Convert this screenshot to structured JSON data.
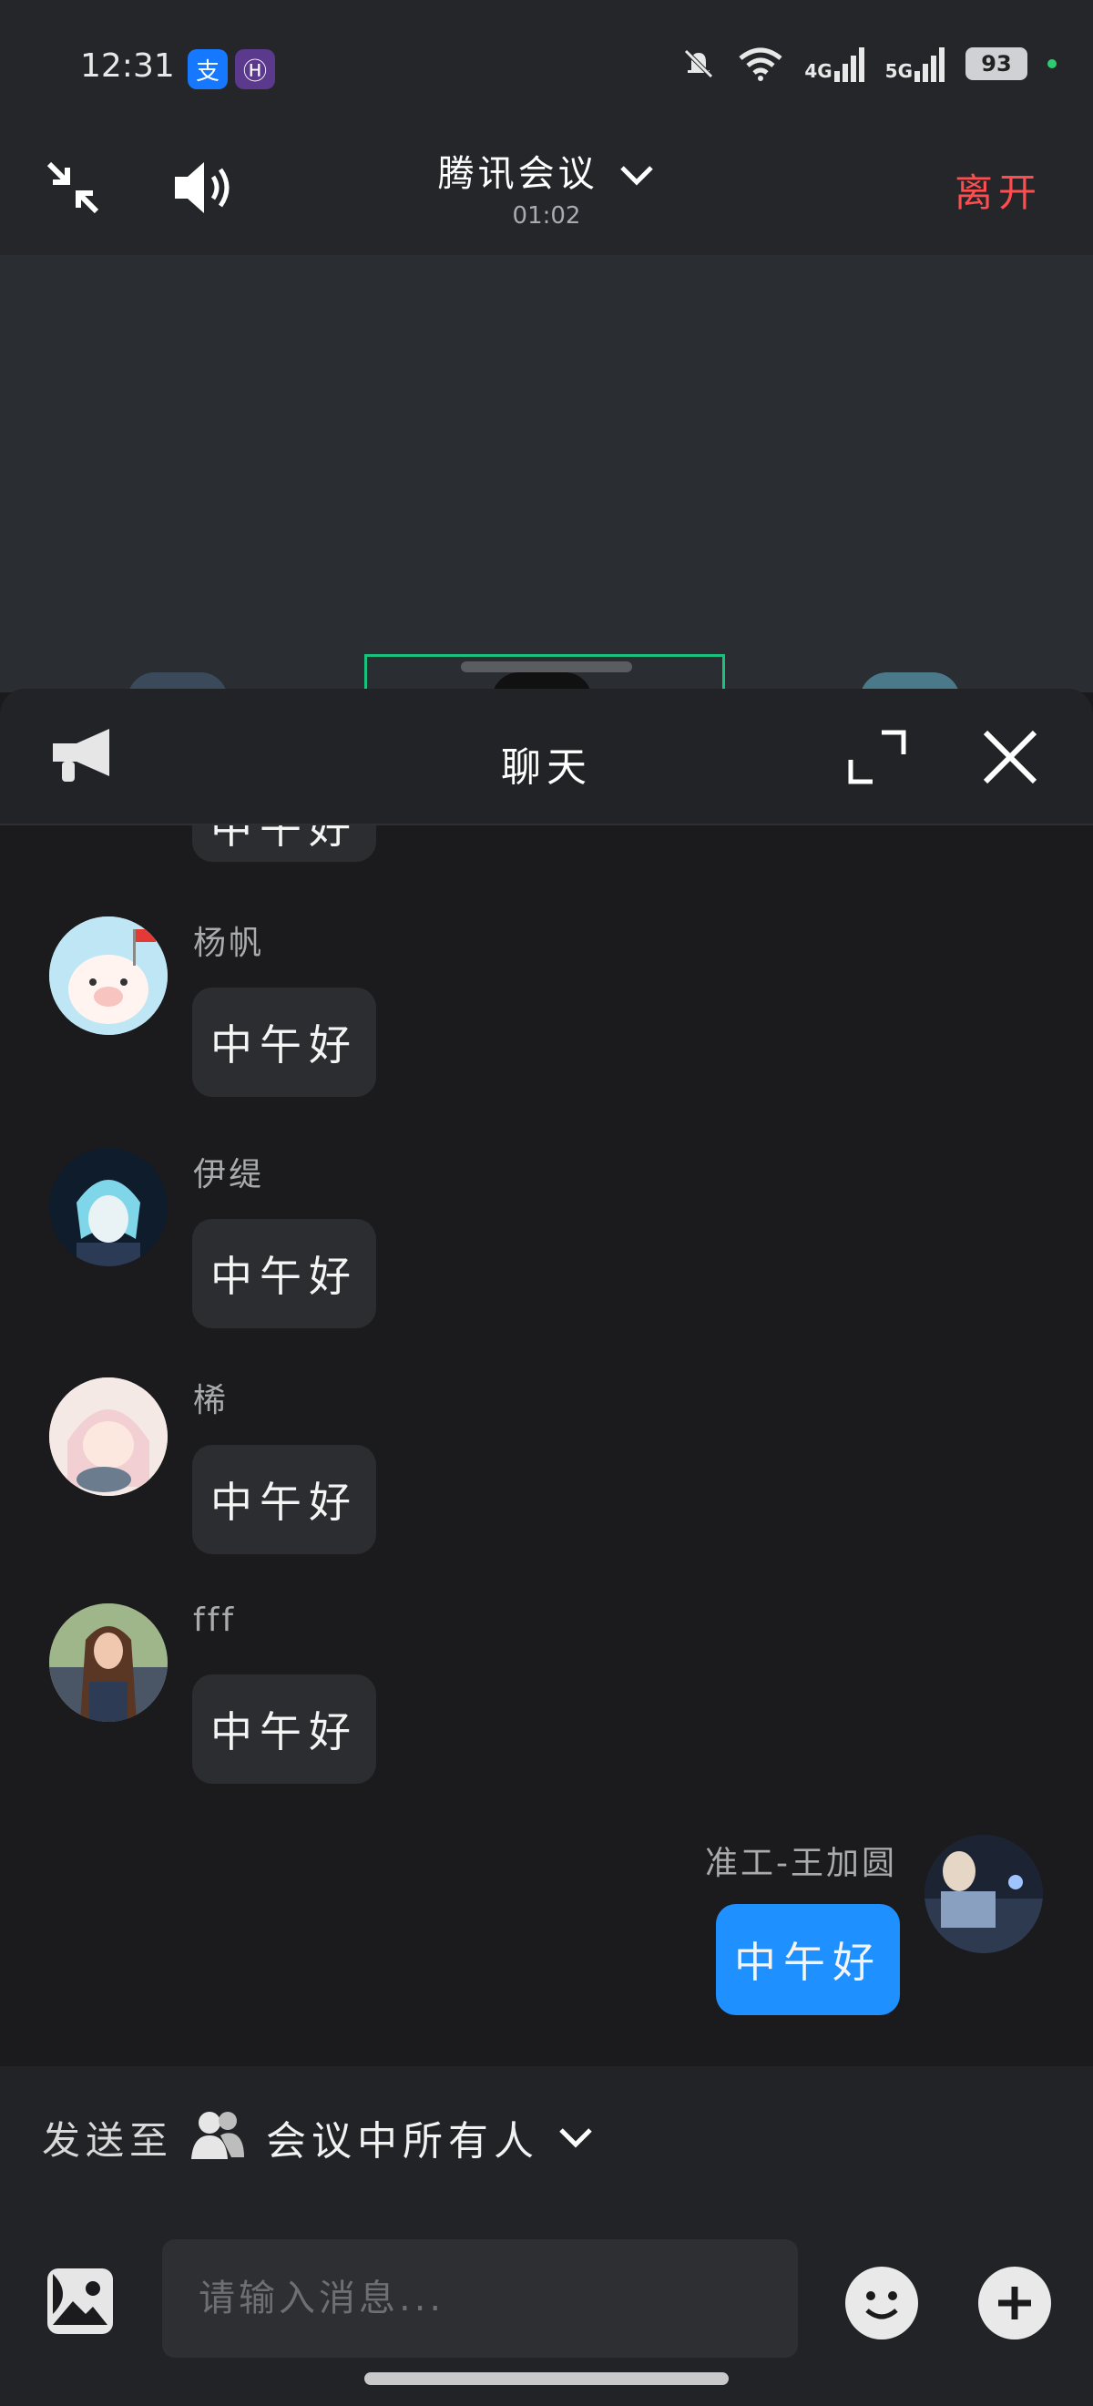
{
  "status_bar": {
    "time": "12:31",
    "apps": [
      "支",
      "Ⓗ"
    ],
    "net1": "4G",
    "net2": "5G",
    "battery": "93"
  },
  "meeting": {
    "title": "腾讯会议",
    "timer": "01:02",
    "leave_label": "离开"
  },
  "chat": {
    "title": "聊天",
    "partial_bubble": "中午好",
    "messages": [
      {
        "sender": "杨帆",
        "text": "中午好",
        "mine": false
      },
      {
        "sender": "伊缇",
        "text": "中午好",
        "mine": false
      },
      {
        "sender": "桸",
        "text": "中午好",
        "mine": false
      },
      {
        "sender": "fff",
        "text": "中午好",
        "mine": false
      },
      {
        "sender": "准工-王加圆",
        "text": "中午好",
        "mine": true
      }
    ]
  },
  "send_to": {
    "label": "发送至",
    "target": "会议中所有人"
  },
  "input": {
    "placeholder": "请输入消息..."
  },
  "colors": {
    "accent": "#1e90ff",
    "leave": "#ff4d4f",
    "active_speaker": "#19c37d"
  }
}
